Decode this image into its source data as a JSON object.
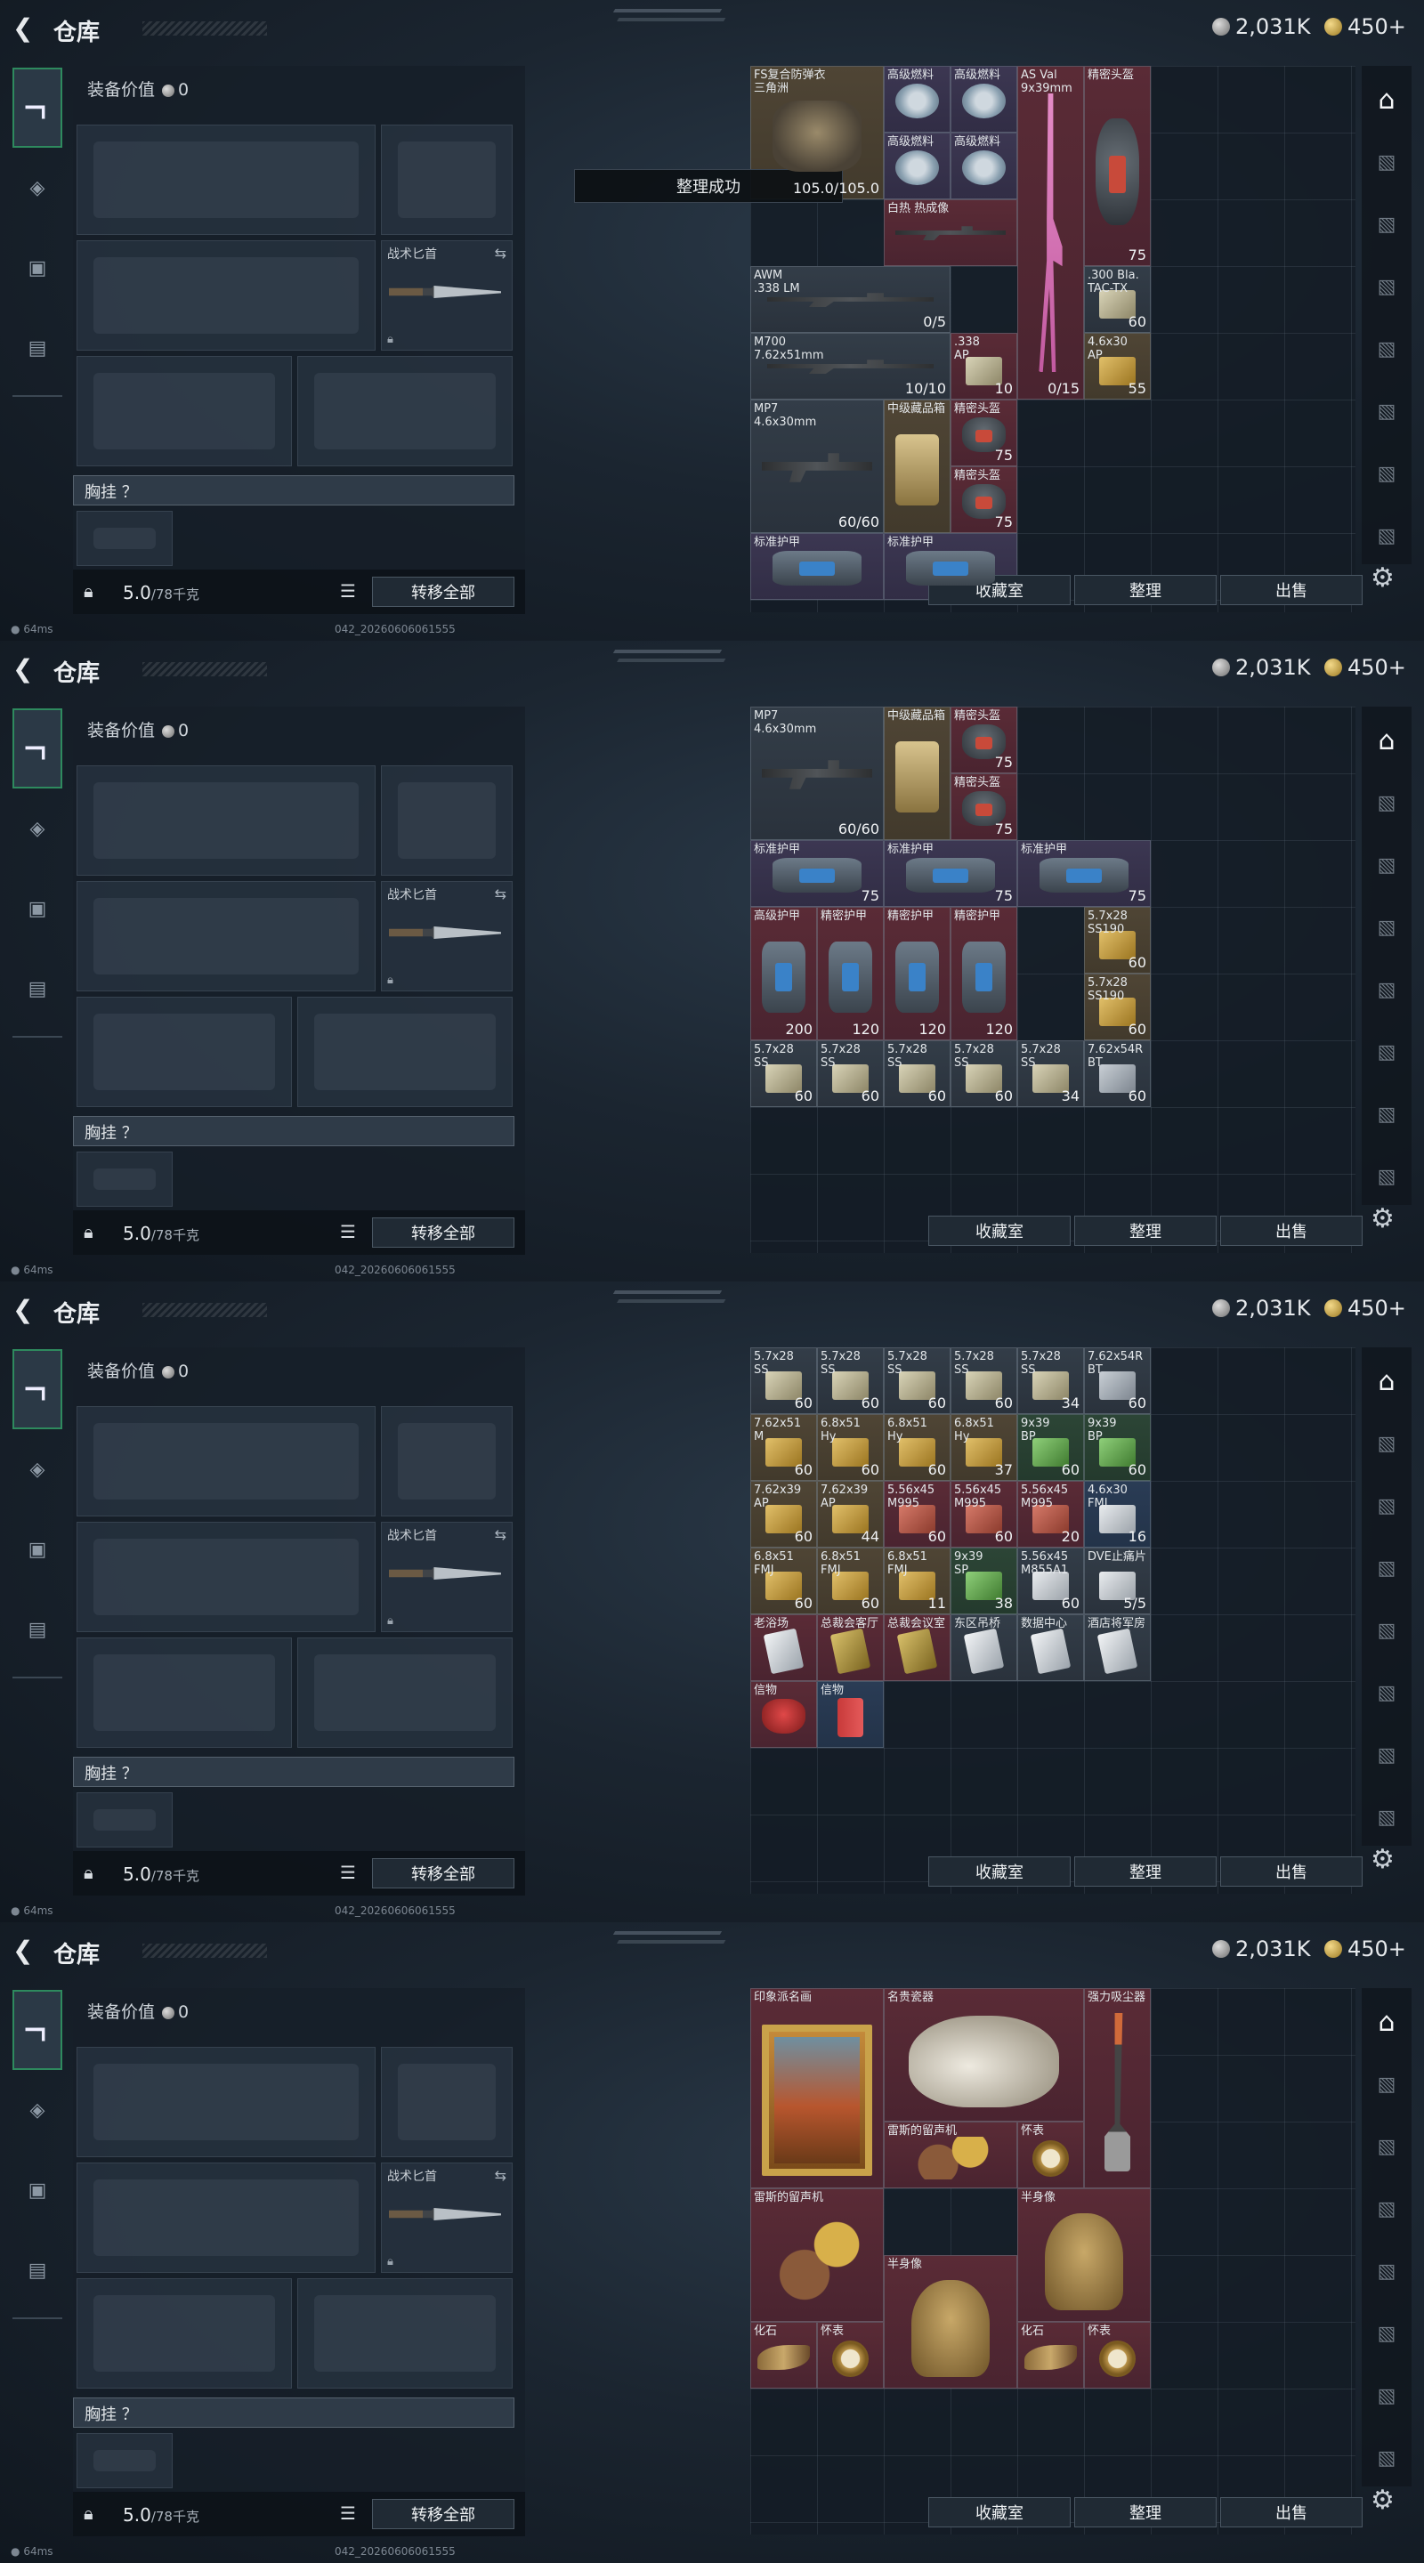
{
  "app": {
    "title": "仓库",
    "currency_silver": "2,031K",
    "currency_gold": "450+",
    "back_icon": "back-arrow-icon"
  },
  "equipment": {
    "value_label": "装备价值",
    "value": "0",
    "knife_label": "战术匕首",
    "chest_label": "胸挂 ？",
    "weight_value": "5.0",
    "weight_max": "/78千克",
    "transfer_all": "转移全部"
  },
  "stash_buttons": {
    "collection": "收藏室",
    "sort": "整理",
    "sell": "出售"
  },
  "toast": "整理成功",
  "status": {
    "ping": "64ms",
    "version": "042_20260606061555"
  },
  "frames": [
    {
      "items": [
        {
          "name": "FS复合防弹衣\n三角洲",
          "qty": "105.0/105.0",
          "color": "c-gold",
          "pic": "p-armor",
          "c": 0,
          "r": 0,
          "w": 2,
          "h": 2
        },
        {
          "name": "高级燃料",
          "color": "c-purple",
          "pic": "p-fuel",
          "c": 2,
          "r": 0,
          "w": 1,
          "h": 1
        },
        {
          "name": "高级燃料",
          "color": "c-purple",
          "pic": "p-fuel",
          "c": 3,
          "r": 0,
          "w": 1,
          "h": 1
        },
        {
          "name": "AS Val\n9x39mm",
          "qty": "0/15",
          "color": "c-red",
          "pic": "p-pink",
          "c": 4,
          "r": 0,
          "w": 1,
          "h": 5
        },
        {
          "name": "精密头盔",
          "qty": "75",
          "color": "c-red",
          "pic": "p-helmet",
          "c": 5,
          "r": 0,
          "w": 1,
          "h": 3
        },
        {
          "name": "高级燃料",
          "color": "c-purple",
          "pic": "p-fuel",
          "c": 2,
          "r": 1,
          "w": 1,
          "h": 1
        },
        {
          "name": "高级燃料",
          "color": "c-purple",
          "pic": "p-fuel",
          "c": 3,
          "r": 1,
          "w": 1,
          "h": 1
        },
        {
          "name": "白热 热成像",
          "color": "c-red",
          "pic": "p-rifle",
          "c": 2,
          "r": 2,
          "w": 2,
          "h": 1
        },
        {
          "name": "AWM\n.338 LM",
          "qty": "0/5",
          "color": "c-gray",
          "pic": "p-rifle",
          "c": 0,
          "r": 3,
          "w": 3,
          "h": 1
        },
        {
          "name": ".300 Bla.\nTAC-TX",
          "qty": "60",
          "color": "c-gray",
          "pic": "p-ammo",
          "c": 5,
          "r": 3,
          "w": 1,
          "h": 1
        },
        {
          "name": "M700\n7.62x51mm",
          "qty": "10/10",
          "color": "c-gray",
          "pic": "p-rifle",
          "c": 0,
          "r": 4,
          "w": 3,
          "h": 1
        },
        {
          "name": ".338\nAP",
          "qty": "10",
          "color": "c-red",
          "pic": "p-ammo",
          "c": 3,
          "r": 4,
          "w": 1,
          "h": 1
        },
        {
          "name": "4.6x30\nAP",
          "qty": "55",
          "color": "c-gold",
          "pic": "p-ammo y",
          "c": 5,
          "r": 4,
          "w": 1,
          "h": 1
        },
        {
          "name": "MP7\n4.6x30mm",
          "qty": "60/60",
          "color": "c-gray",
          "pic": "p-rifle",
          "c": 0,
          "r": 5,
          "w": 2,
          "h": 2
        },
        {
          "name": "中级藏品箱",
          "color": "c-gold",
          "pic": "p-box",
          "c": 2,
          "r": 5,
          "w": 1,
          "h": 2
        },
        {
          "name": "精密头盔",
          "qty": "75",
          "color": "c-red",
          "pic": "p-helmet",
          "c": 3,
          "r": 5,
          "w": 1,
          "h": 1
        },
        {
          "name": "精密头盔",
          "qty": "75",
          "color": "c-red",
          "pic": "p-helmet",
          "c": 3,
          "r": 6,
          "w": 1,
          "h": 1
        },
        {
          "name": "标准护甲",
          "color": "c-purple",
          "pic": "p-bag",
          "c": 0,
          "r": 7,
          "w": 2,
          "h": 1
        },
        {
          "name": "标准护甲",
          "color": "c-purple",
          "pic": "p-bag",
          "c": 2,
          "r": 7,
          "w": 2,
          "h": 1
        }
      ]
    },
    {
      "items": [
        {
          "name": "MP7\n4.6x30mm",
          "qty": "60/60",
          "color": "c-gray",
          "pic": "p-rifle",
          "c": 0,
          "r": 0,
          "w": 2,
          "h": 2
        },
        {
          "name": "中级藏品箱",
          "color": "c-gold",
          "pic": "p-box",
          "c": 2,
          "r": 0,
          "w": 1,
          "h": 2
        },
        {
          "name": "精密头盔",
          "qty": "75",
          "color": "c-red",
          "pic": "p-helmet",
          "c": 3,
          "r": 0,
          "w": 1,
          "h": 1
        },
        {
          "name": "精密头盔",
          "qty": "75",
          "color": "c-red",
          "pic": "p-helmet",
          "c": 3,
          "r": 1,
          "w": 1,
          "h": 1
        },
        {
          "name": "标准护甲",
          "qty": "75",
          "color": "c-purple",
          "pic": "p-bag",
          "c": 0,
          "r": 2,
          "w": 2,
          "h": 1
        },
        {
          "name": "标准护甲",
          "qty": "75",
          "color": "c-purple",
          "pic": "p-bag",
          "c": 2,
          "r": 2,
          "w": 2,
          "h": 1
        },
        {
          "name": "标准护甲",
          "qty": "75",
          "color": "c-purple",
          "pic": "p-bag",
          "c": 4,
          "r": 2,
          "w": 2,
          "h": 1
        },
        {
          "name": "高级护甲",
          "qty": "200",
          "color": "c-red",
          "pic": "p-bag",
          "c": 0,
          "r": 3,
          "w": 1,
          "h": 2
        },
        {
          "name": "精密护甲",
          "qty": "120",
          "color": "c-red",
          "pic": "p-bag",
          "c": 1,
          "r": 3,
          "w": 1,
          "h": 2
        },
        {
          "name": "精密护甲",
          "qty": "120",
          "color": "c-red",
          "pic": "p-bag",
          "c": 2,
          "r": 3,
          "w": 1,
          "h": 2
        },
        {
          "name": "精密护甲",
          "qty": "120",
          "color": "c-red",
          "pic": "p-bag",
          "c": 3,
          "r": 3,
          "w": 1,
          "h": 2
        },
        {
          "name": "5.7x28\nSS190",
          "qty": "60",
          "color": "c-gold",
          "pic": "p-ammo y",
          "c": 5,
          "r": 3,
          "w": 1,
          "h": 1
        },
        {
          "name": "5.7x28\nSS190",
          "qty": "60",
          "color": "c-gold",
          "pic": "p-ammo y",
          "c": 5,
          "r": 4,
          "w": 1,
          "h": 1
        },
        {
          "name": "5.7x28\nSS",
          "qty": "60",
          "color": "c-gray",
          "pic": "p-ammo",
          "c": 0,
          "r": 5,
          "w": 1,
          "h": 1
        },
        {
          "name": "5.7x28\nSS",
          "qty": "60",
          "color": "c-gray",
          "pic": "p-ammo",
          "c": 1,
          "r": 5,
          "w": 1,
          "h": 1
        },
        {
          "name": "5.7x28\nSS",
          "qty": "60",
          "color": "c-gray",
          "pic": "p-ammo",
          "c": 2,
          "r": 5,
          "w": 1,
          "h": 1
        },
        {
          "name": "5.7x28\nSS",
          "qty": "60",
          "color": "c-gray",
          "pic": "p-ammo",
          "c": 3,
          "r": 5,
          "w": 1,
          "h": 1
        },
        {
          "name": "5.7x28\nSS",
          "qty": "34",
          "color": "c-gray",
          "pic": "p-ammo",
          "c": 4,
          "r": 5,
          "w": 1,
          "h": 1
        },
        {
          "name": "7.62x54R\nBT",
          "qty": "60",
          "color": "c-gray",
          "pic": "p-ammo b",
          "c": 5,
          "r": 5,
          "w": 1,
          "h": 1
        }
      ]
    },
    {
      "items": [
        {
          "name": "5.7x28\nSS",
          "qty": "60",
          "color": "c-gray",
          "pic": "p-ammo",
          "c": 0,
          "r": 0,
          "w": 1,
          "h": 1
        },
        {
          "name": "5.7x28\nSS",
          "qty": "60",
          "color": "c-gray",
          "pic": "p-ammo",
          "c": 1,
          "r": 0,
          "w": 1,
          "h": 1
        },
        {
          "name": "5.7x28\nSS",
          "qty": "60",
          "color": "c-gray",
          "pic": "p-ammo",
          "c": 2,
          "r": 0,
          "w": 1,
          "h": 1
        },
        {
          "name": "5.7x28\nSS",
          "qty": "60",
          "color": "c-gray",
          "pic": "p-ammo",
          "c": 3,
          "r": 0,
          "w": 1,
          "h": 1
        },
        {
          "name": "5.7x28\nSS",
          "qty": "34",
          "color": "c-gray",
          "pic": "p-ammo",
          "c": 4,
          "r": 0,
          "w": 1,
          "h": 1
        },
        {
          "name": "7.62x54R\nBT",
          "qty": "60",
          "color": "c-gray",
          "pic": "p-ammo b",
          "c": 5,
          "r": 0,
          "w": 1,
          "h": 1
        },
        {
          "name": "7.62x51\nM",
          "qty": "60",
          "color": "c-gold",
          "pic": "p-ammo y",
          "c": 0,
          "r": 1,
          "w": 1,
          "h": 1
        },
        {
          "name": "6.8x51\nHy",
          "qty": "60",
          "color": "c-gold",
          "pic": "p-ammo y",
          "c": 1,
          "r": 1,
          "w": 1,
          "h": 1
        },
        {
          "name": "6.8x51\nHy",
          "qty": "60",
          "color": "c-gold",
          "pic": "p-ammo y",
          "c": 2,
          "r": 1,
          "w": 1,
          "h": 1
        },
        {
          "name": "6.8x51\nHy",
          "qty": "37",
          "color": "c-gold",
          "pic": "p-ammo y",
          "c": 3,
          "r": 1,
          "w": 1,
          "h": 1
        },
        {
          "name": "9x39\nBP",
          "qty": "60",
          "color": "c-green",
          "pic": "p-ammo g",
          "c": 4,
          "r": 1,
          "w": 1,
          "h": 1
        },
        {
          "name": "9x39\nBP",
          "qty": "60",
          "color": "c-green",
          "pic": "p-ammo g",
          "c": 5,
          "r": 1,
          "w": 1,
          "h": 1
        },
        {
          "name": "7.62x39\nAP",
          "qty": "60",
          "color": "c-gold",
          "pic": "p-ammo y",
          "c": 0,
          "r": 2,
          "w": 1,
          "h": 1
        },
        {
          "name": "7.62x39\nAP",
          "qty": "44",
          "color": "c-gold",
          "pic": "p-ammo y",
          "c": 1,
          "r": 2,
          "w": 1,
          "h": 1
        },
        {
          "name": "5.56x45\nM995",
          "qty": "60",
          "color": "c-red",
          "pic": "p-ammo r",
          "c": 2,
          "r": 2,
          "w": 1,
          "h": 1
        },
        {
          "name": "5.56x45\nM995",
          "qty": "60",
          "color": "c-red",
          "pic": "p-ammo r",
          "c": 3,
          "r": 2,
          "w": 1,
          "h": 1
        },
        {
          "name": "5.56x45\nM995",
          "qty": "20",
          "color": "c-red",
          "pic": "p-ammo r",
          "c": 4,
          "r": 2,
          "w": 1,
          "h": 1
        },
        {
          "name": "4.6x30\nFMJ",
          "qty": "16",
          "color": "c-blue",
          "pic": "p-ammo w",
          "c": 5,
          "r": 2,
          "w": 1,
          "h": 1
        },
        {
          "name": "6.8x51\nFMJ",
          "qty": "60",
          "color": "c-gold",
          "pic": "p-ammo y",
          "c": 0,
          "r": 3,
          "w": 1,
          "h": 1
        },
        {
          "name": "6.8x51\nFMJ",
          "qty": "60",
          "color": "c-gold",
          "pic": "p-ammo y",
          "c": 1,
          "r": 3,
          "w": 1,
          "h": 1
        },
        {
          "name": "6.8x51\nFMJ",
          "qty": "11",
          "color": "c-gold",
          "pic": "p-ammo y",
          "c": 2,
          "r": 3,
          "w": 1,
          "h": 1
        },
        {
          "name": "9x39\nSP",
          "qty": "38",
          "color": "c-green",
          "pic": "p-ammo g",
          "c": 3,
          "r": 3,
          "w": 1,
          "h": 1
        },
        {
          "name": "5.56x45\nM855A1",
          "qty": "60",
          "color": "c-gray",
          "pic": "p-ammo w",
          "c": 4,
          "r": 3,
          "w": 1,
          "h": 1
        },
        {
          "name": "DVE止痛片",
          "qty": "5/5",
          "color": "c-gray",
          "pic": "p-ammo w",
          "c": 5,
          "r": 3,
          "w": 1,
          "h": 1
        },
        {
          "name": "老浴场",
          "color": "c-red",
          "pic": "p-card",
          "c": 0,
          "r": 4,
          "w": 1,
          "h": 1
        },
        {
          "name": "总裁会客厅",
          "color": "c-red",
          "pic": "p-card y",
          "c": 1,
          "r": 4,
          "w": 1,
          "h": 1
        },
        {
          "name": "总裁会议室",
          "color": "c-red",
          "pic": "p-card y",
          "c": 2,
          "r": 4,
          "w": 1,
          "h": 1
        },
        {
          "name": "东区吊桥",
          "color": "c-gray",
          "pic": "p-card",
          "c": 3,
          "r": 4,
          "w": 1,
          "h": 1
        },
        {
          "name": "数据中心",
          "color": "c-gray",
          "pic": "p-card",
          "c": 4,
          "r": 4,
          "w": 1,
          "h": 1
        },
        {
          "name": "酒店将军房",
          "color": "c-gray",
          "pic": "p-card",
          "c": 5,
          "r": 4,
          "w": 1,
          "h": 1
        },
        {
          "name": "信物",
          "color": "c-red",
          "pic": "p-mask",
          "c": 0,
          "r": 5,
          "w": 1,
          "h": 1
        },
        {
          "name": "信物",
          "color": "c-blue",
          "pic": "p-book",
          "c": 1,
          "r": 5,
          "w": 1,
          "h": 1
        }
      ]
    },
    {
      "items": [
        {
          "name": "印象派名画",
          "color": "c-red",
          "pic": "p-paint",
          "c": 0,
          "r": 0,
          "w": 2,
          "h": 3
        },
        {
          "name": "名贵瓷器",
          "color": "c-red",
          "pic": "p-vase",
          "c": 2,
          "r": 0,
          "w": 3,
          "h": 2
        },
        {
          "name": "强力吸尘器",
          "color": "c-red",
          "pic": "p-vac",
          "c": 5,
          "r": 0,
          "w": 1,
          "h": 3
        },
        {
          "name": "雷斯的留声机",
          "color": "c-red",
          "pic": "p-phono",
          "c": 2,
          "r": 2,
          "w": 2,
          "h": 1
        },
        {
          "name": "怀表",
          "color": "c-red",
          "pic": "p-watch",
          "c": 4,
          "r": 2,
          "w": 1,
          "h": 1
        },
        {
          "name": "雷斯的留声机",
          "color": "c-red",
          "pic": "p-phono",
          "c": 0,
          "r": 3,
          "w": 2,
          "h": 2
        },
        {
          "name": "半身像",
          "color": "c-red",
          "pic": "p-bust",
          "c": 4,
          "r": 3,
          "w": 2,
          "h": 2
        },
        {
          "name": "半身像",
          "color": "c-red",
          "pic": "p-bust",
          "c": 2,
          "r": 4,
          "w": 2,
          "h": 2
        },
        {
          "name": "化石",
          "color": "c-red",
          "pic": "p-fossil",
          "c": 0,
          "r": 5,
          "w": 1,
          "h": 1
        },
        {
          "name": "怀表",
          "color": "c-red",
          "pic": "p-watch",
          "c": 1,
          "r": 5,
          "w": 1,
          "h": 1
        },
        {
          "name": "化石",
          "color": "c-red",
          "pic": "p-fossil",
          "c": 4,
          "r": 5,
          "w": 1,
          "h": 1
        },
        {
          "name": "怀表",
          "color": "c-red",
          "pic": "p-watch",
          "c": 5,
          "r": 5,
          "w": 1,
          "h": 1
        }
      ]
    }
  ]
}
